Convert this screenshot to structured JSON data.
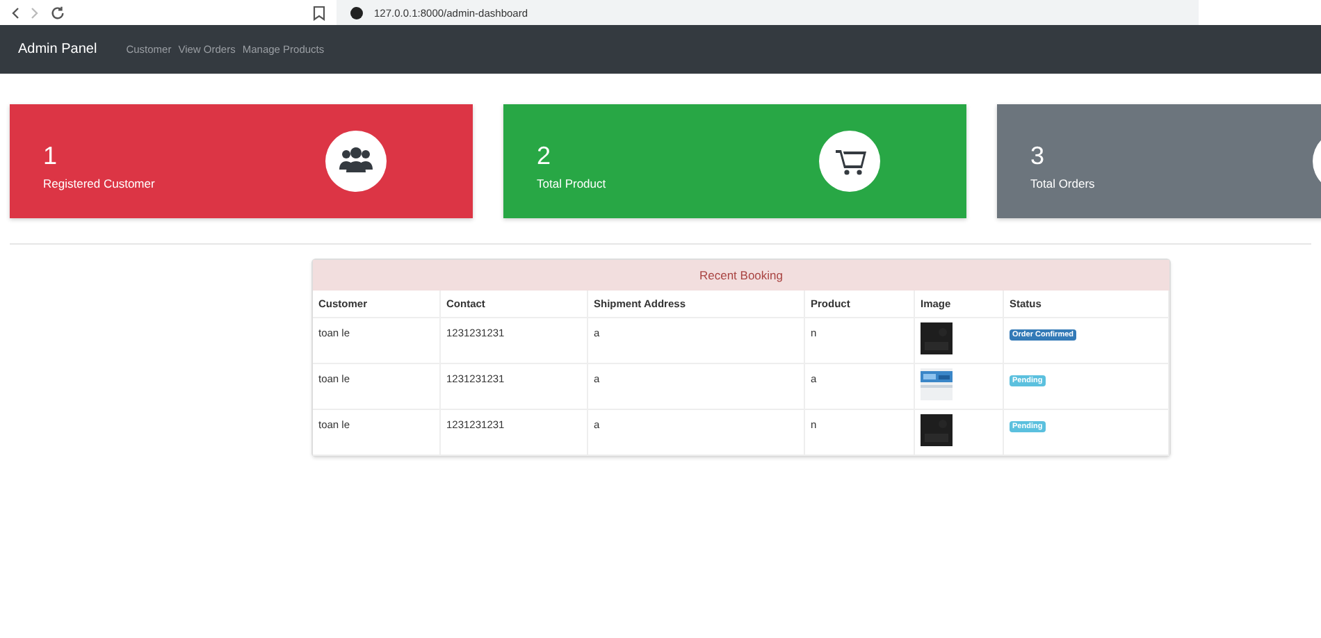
{
  "browser": {
    "url": "127.0.0.1:8000/admin-dashboard"
  },
  "navbar": {
    "brand": "Admin Panel",
    "links": [
      "Customer",
      "View Orders",
      "Manage Products"
    ]
  },
  "cards": [
    {
      "count": "1",
      "label": "Registered Customer",
      "color": "#dc3545",
      "kind": "users"
    },
    {
      "count": "2",
      "label": "Total Product",
      "color": "#28a745",
      "kind": "cart"
    },
    {
      "count": "3",
      "label": "Total Orders",
      "color": "#6c757d",
      "kind": "blank"
    }
  ],
  "table": {
    "title": "Recent Booking",
    "columns": [
      "Customer",
      "Contact",
      "Shipment Address",
      "Product",
      "Image",
      "Status"
    ],
    "rows": [
      {
        "customer": "toan le",
        "contact": "1231231231",
        "address": "a",
        "product": "n",
        "image": {
          "kind": "dark"
        },
        "status": {
          "text": "Order Confirmed",
          "kind": "confirmed"
        }
      },
      {
        "customer": "toan le",
        "contact": "1231231231",
        "address": "a",
        "product": "a",
        "image": {
          "kind": "light"
        },
        "status": {
          "text": "Pending",
          "kind": "pending"
        }
      },
      {
        "customer": "toan le",
        "contact": "1231231231",
        "address": "a",
        "product": "n",
        "image": {
          "kind": "dark"
        },
        "status": {
          "text": "Pending",
          "kind": "pending"
        }
      }
    ]
  }
}
